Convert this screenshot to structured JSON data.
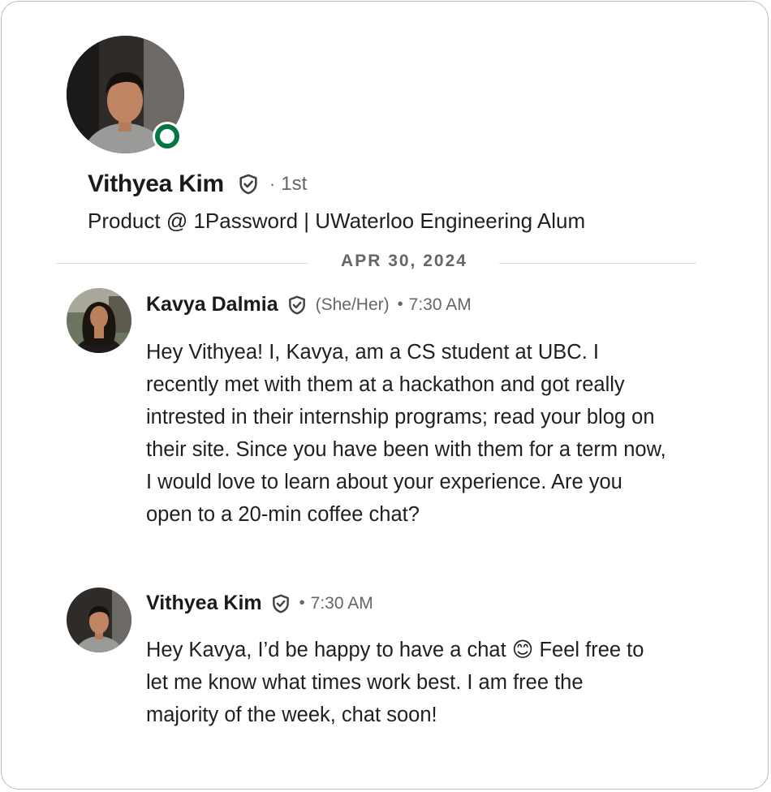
{
  "profile": {
    "name": "Vithyea Kim",
    "degree": "1st",
    "separator": "·",
    "headline": "Product @ 1Password | UWaterloo Engineering Alum",
    "presence_color": "#057642"
  },
  "divider": {
    "date": "APR 30, 2024"
  },
  "messages": [
    {
      "sender": "Kavya Dalmia",
      "pronouns": "(She/Her)",
      "bullet": "•",
      "time": "7:30 AM",
      "text": "Hey Vithyea! I, Kavya, am a CS student at UBC. I recently met with them at a hackathon and got really intrested in their internship programs; read your blog on their site. Since you have been with them for a term now, I would love to learn about your experience. Are you open to a 20-min coffee chat?"
    },
    {
      "sender": "Vithyea Kim",
      "bullet": "•",
      "time": "7:30 AM",
      "text": "Hey Kavya, I’d be happy to have a chat 😊 Feel free to let me know what times work best. I am free the majority of the week, chat soon!"
    }
  ],
  "icons": {
    "verified": "verified-shield-icon"
  }
}
